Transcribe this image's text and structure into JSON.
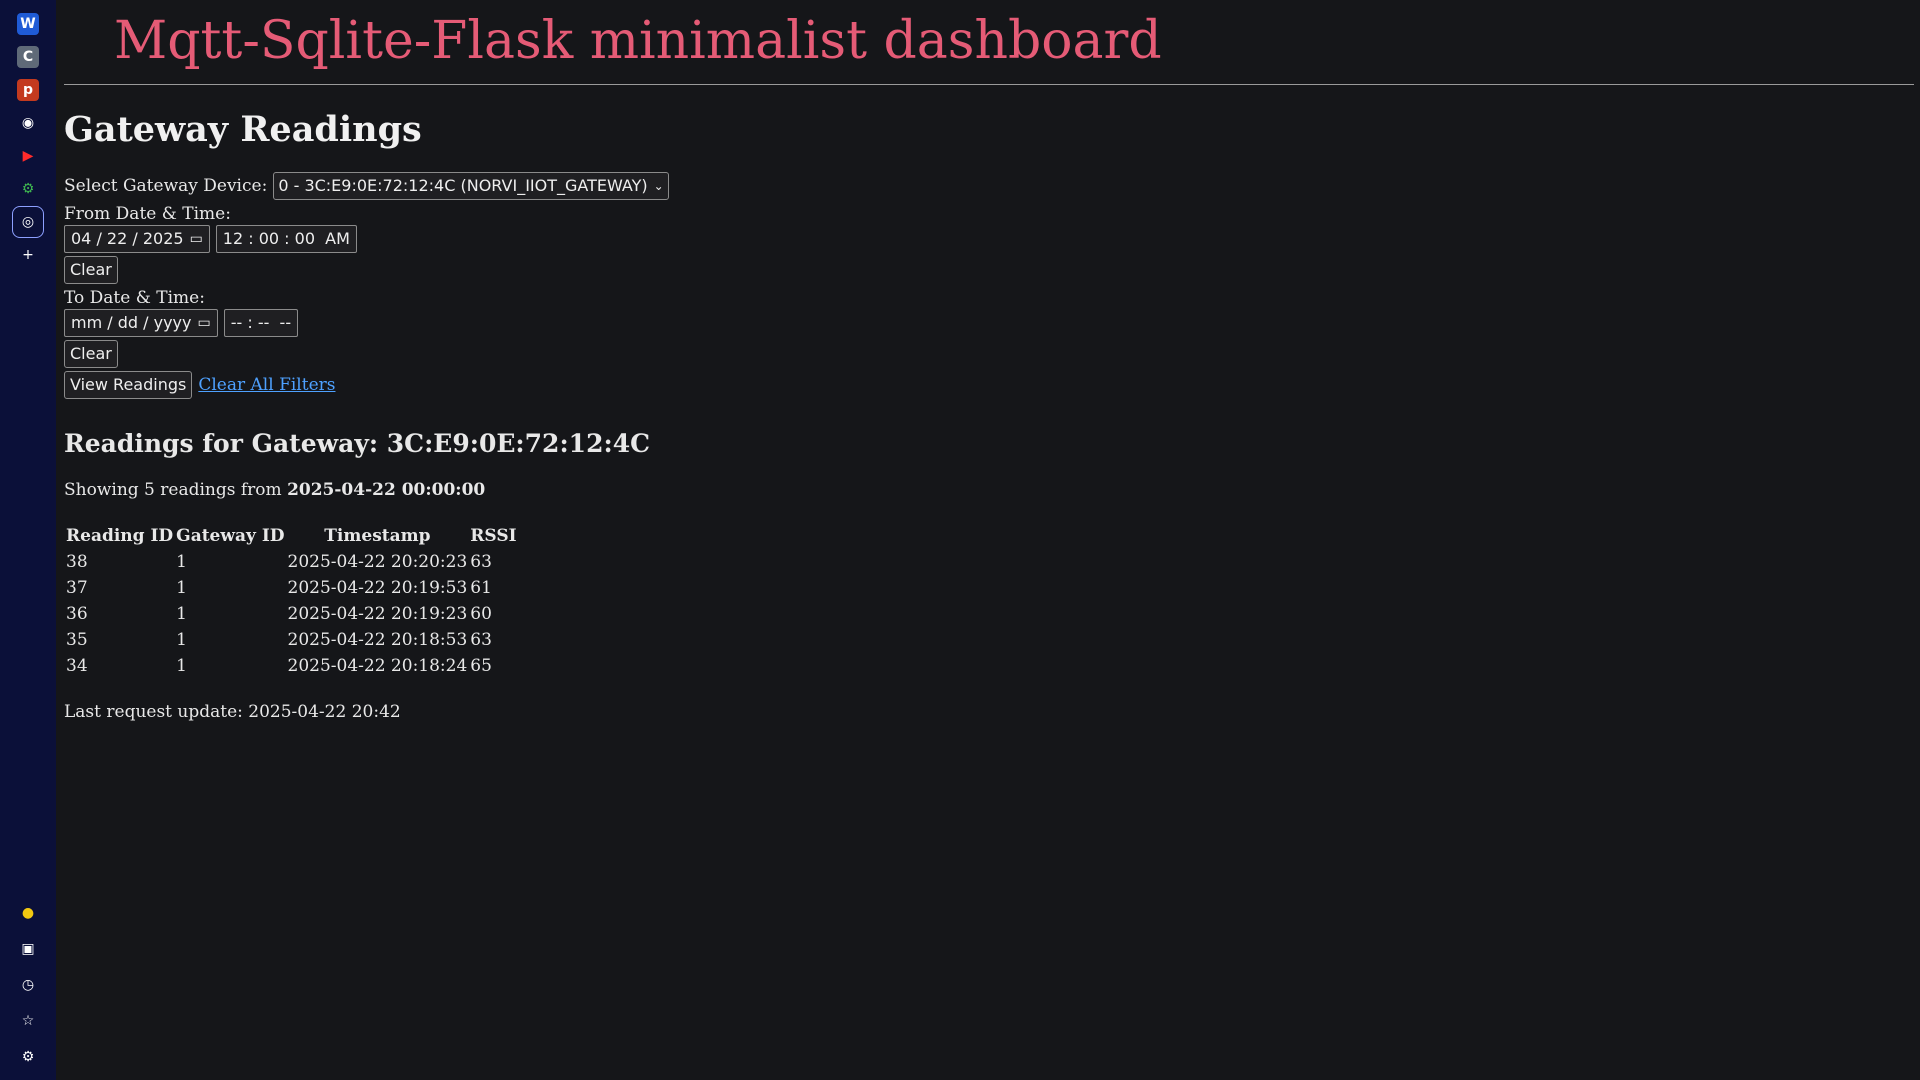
{
  "rail": {
    "top": [
      {
        "name": "w-app-icon",
        "glyph": "W",
        "bg": "#1f5bd6",
        "fg": "#ffffff"
      },
      {
        "name": "c-app-icon",
        "glyph": "C",
        "bg": "#5f6a78",
        "fg": "#ffffff"
      },
      {
        "name": "p-app-icon",
        "glyph": "p",
        "bg": "#c33a1f",
        "fg": "#ffffff"
      },
      {
        "name": "github-icon",
        "glyph": "◉",
        "bg": "transparent",
        "fg": "#ffffff"
      },
      {
        "name": "youtube-icon",
        "glyph": "▶",
        "bg": "transparent",
        "fg": "#ff2b2b"
      },
      {
        "name": "green-extension-icon",
        "glyph": "⚙",
        "bg": "transparent",
        "fg": "#3fb950"
      },
      {
        "name": "globe-icon",
        "glyph": "◎",
        "bg": "transparent",
        "fg": "#ffffff"
      },
      {
        "name": "add-icon",
        "glyph": "+",
        "bg": "transparent",
        "fg": "#ffffff"
      }
    ],
    "bottom": [
      {
        "name": "chat-icon",
        "glyph": "●",
        "fg": "#f2c811"
      },
      {
        "name": "save-icon",
        "glyph": "▣",
        "fg": "#ffffff"
      },
      {
        "name": "history-icon",
        "glyph": "◷",
        "fg": "#ffffff"
      },
      {
        "name": "favorites-icon",
        "glyph": "☆",
        "fg": "#ffffff"
      },
      {
        "name": "settings-icon",
        "glyph": "⚙",
        "fg": "#ffffff"
      }
    ]
  },
  "header": {
    "title": "Mqtt-Sqlite-Flask minimalist dashboard"
  },
  "section_title": "Gateway Readings",
  "form": {
    "device_label": "Select Gateway Device:",
    "device_value": "0 - 3C:E9:0E:72:12:4C (NORVI_IIOT_GATEWAY)",
    "from_label": "From Date & Time:",
    "from_date": "04 / 22 / 2025",
    "from_time": "12 : 00 : 00  AM",
    "clear_label": "Clear",
    "to_label": "To Date & Time:",
    "to_date": "mm / dd / yyyy",
    "to_time": "-- : --  --",
    "view_label": "View Readings",
    "clear_all_label": "Clear All Filters"
  },
  "readings": {
    "title": "Readings for Gateway: 3C:E9:0E:72:12:4C",
    "showing_prefix": "Showing 5 readings from",
    "showing_date": "2025-04-22 00:00:00",
    "columns": [
      "Reading ID",
      "Gateway ID",
      "Timestamp",
      "RSSI"
    ],
    "rows": [
      [
        "38",
        "1",
        "2025-04-22 20:20:23",
        "63"
      ],
      [
        "37",
        "1",
        "2025-04-22 20:19:53",
        "61"
      ],
      [
        "36",
        "1",
        "2025-04-22 20:19:23",
        "60"
      ],
      [
        "35",
        "1",
        "2025-04-22 20:18:53",
        "63"
      ],
      [
        "34",
        "1",
        "2025-04-22 20:18:24",
        "65"
      ]
    ]
  },
  "footer": "Last request update: 2025-04-22 20:42",
  "colors": {
    "accent": "#e55b76",
    "link": "#4ea1ff",
    "background": "#151619",
    "rail": "#0b1039"
  }
}
